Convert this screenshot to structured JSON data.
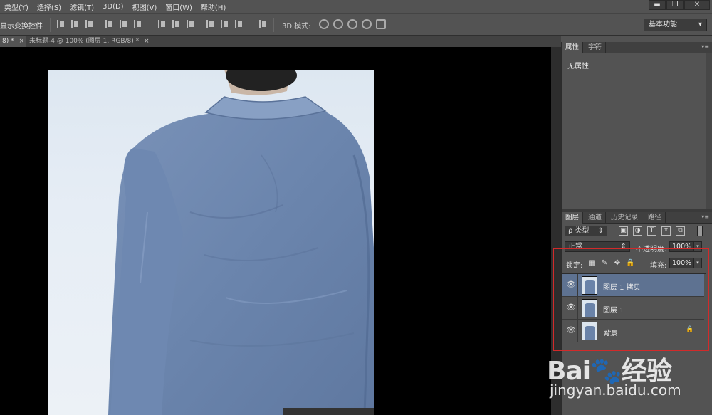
{
  "menubar": {
    "items": [
      "类型(Y)",
      "选择(S)",
      "滤镜(T)",
      "3D(D)",
      "视图(V)",
      "窗口(W)",
      "帮助(H)"
    ],
    "minimize": "▬",
    "restore": "❐",
    "close": "✕"
  },
  "options": {
    "show_transform": "显示变换控件",
    "mode_label": "3D 模式:",
    "workspace": "基本功能",
    "workspace_arrow": "▾"
  },
  "doc_tabs": [
    {
      "label": "8) * ",
      "close": "×"
    },
    {
      "label": "未标题-4 @ 100% (图层 1, RGB/8) * ",
      "close": "×"
    }
  ],
  "properties_panel": {
    "tabs": [
      "属性",
      "字符"
    ],
    "content": "无属性",
    "menu": "▾≡"
  },
  "layers_panel": {
    "tabs": [
      "图层",
      "通道",
      "历史记录",
      "路径"
    ],
    "menu": "▾≡",
    "filter_type": "ρ 类型",
    "filter_arrow": "⇕",
    "filter_icons": [
      "▣",
      "◑",
      "T",
      "⌗",
      "⧉"
    ],
    "blend_mode": "正常",
    "blend_arrow": "⇕",
    "opacity_label": "不透明度:",
    "opacity_value": "100%",
    "lock_label": "锁定:",
    "lock_icons": [
      "▦",
      "✎",
      "✥",
      "🔒"
    ],
    "fill_label": "填充:",
    "fill_value": "100%",
    "dropdown_arrow": "▾",
    "eye": "👁",
    "lock_glyph": "🔒",
    "layers": [
      {
        "name": "图层 1 拷贝",
        "selected": true,
        "locked": false
      },
      {
        "name": "图层 1",
        "selected": false,
        "locked": false
      },
      {
        "name": "背景",
        "selected": false,
        "locked": true
      }
    ]
  },
  "watermark": {
    "logo": "Bai🐾经验",
    "url": "jingyan.baidu.com"
  }
}
